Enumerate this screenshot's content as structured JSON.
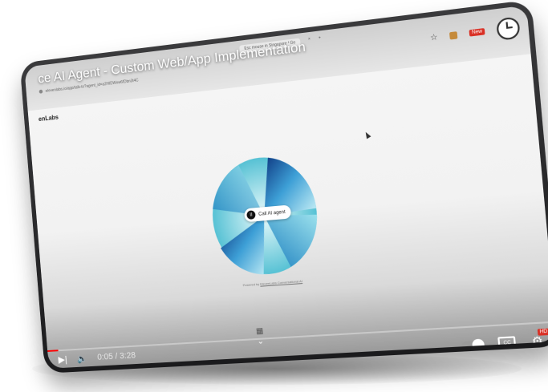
{
  "browser": {
    "tabs": [
      "",
      "Esc mouse in Singapore | Go",
      "×",
      "+"
    ],
    "address": "elevenlabs.io/app/talk-to?agent_id=a2HIDWxw6fDbn3t4C"
  },
  "video": {
    "title": "ce AI Agent - Custom Web/App Implementation",
    "time_current": "0:05",
    "time_total": "3:28",
    "time_separator": " / ",
    "progress": 0.024
  },
  "page": {
    "brand": "enLabs",
    "call_button_label": "Call AI agent",
    "powered_by_prefix": "Powered by ",
    "powered_by_link": "ElevenLabs Conversational AI"
  },
  "player": {
    "hd_badge": "HD",
    "cc_label": "CC"
  },
  "icons": {
    "next": "next-icon",
    "volume": "volume-icon",
    "chevron": "chevron-down-icon",
    "settings": "settings-icon",
    "clock": "clock-icon",
    "star": "star-icon"
  },
  "colors": {
    "orb_dark": "#0b3d91",
    "orb_light": "#7ed6e6",
    "progress": "#ff0000",
    "hd_badge": "#d93025"
  }
}
